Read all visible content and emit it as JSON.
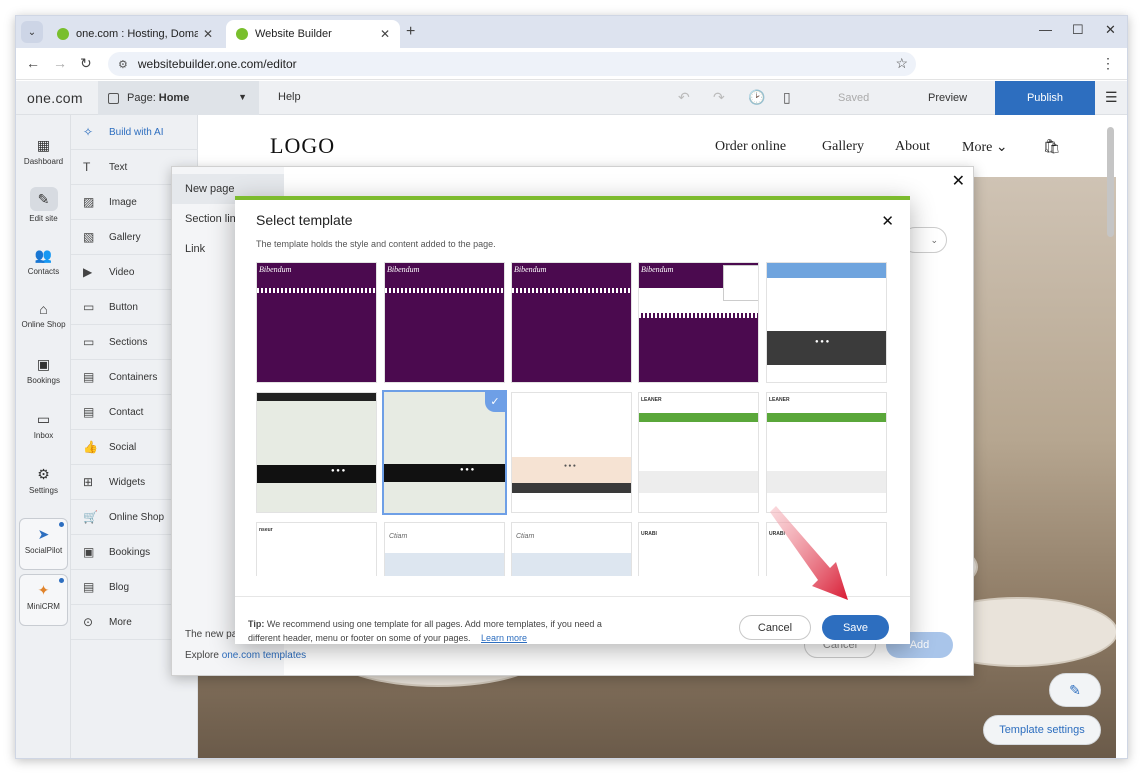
{
  "browser": {
    "tabs": [
      {
        "title": "one.com : Hosting, Domain, Email"
      },
      {
        "title": "Website Builder"
      }
    ],
    "url": "websitebuilder.one.com/editor"
  },
  "editor": {
    "brand": "one.com",
    "page_prefix": "Page:",
    "page_name": "Home",
    "help": "Help",
    "saved": "Saved",
    "preview": "Preview",
    "publish": "Publish"
  },
  "rail": [
    {
      "label": "Dashboard"
    },
    {
      "label": "Edit site"
    },
    {
      "label": "Contacts"
    },
    {
      "label": "Online Shop"
    },
    {
      "label": "Bookings"
    },
    {
      "label": "Inbox"
    },
    {
      "label": "Settings"
    },
    {
      "label": "SocialPilot"
    },
    {
      "label": "MiniCRM"
    }
  ],
  "widgets": [
    {
      "label": "Build with AI"
    },
    {
      "label": "Text"
    },
    {
      "label": "Image"
    },
    {
      "label": "Gallery"
    },
    {
      "label": "Video"
    },
    {
      "label": "Button"
    },
    {
      "label": "Sections"
    },
    {
      "label": "Containers"
    },
    {
      "label": "Contact"
    },
    {
      "label": "Social"
    },
    {
      "label": "Widgets"
    },
    {
      "label": "Online Shop"
    },
    {
      "label": "Bookings"
    },
    {
      "label": "Blog"
    },
    {
      "label": "More"
    }
  ],
  "site": {
    "logo": "LOGO",
    "nav": [
      "Order online",
      "Gallery",
      "About",
      "More"
    ],
    "template_settings": "Template settings"
  },
  "add_page_dialog": {
    "items": [
      "New page",
      "Section link",
      "Link"
    ],
    "footer_text": "The new page",
    "explore": "Explore",
    "explore_link": "one.com templates",
    "cancel": "Cancel",
    "add": "Add"
  },
  "template_dialog": {
    "title": "Select template",
    "subtitle": "The template holds the style and content added to the page.",
    "tip_label": "Tip:",
    "tip_text": "We recommend using one template for all pages. Add more templates, if you need a different header, menu or footer on some of your pages.",
    "learn_more": "Learn more",
    "cancel": "Cancel",
    "save": "Save",
    "thumbs": [
      {
        "name": "Bibendum"
      },
      {
        "name": "Bibendum"
      },
      {
        "name": "Bibendum"
      },
      {
        "name": "Bibendum"
      },
      {
        "name": ""
      },
      {
        "name": ""
      },
      {
        "name": "",
        "selected": true
      },
      {
        "name": ""
      },
      {
        "name": "LEANER"
      },
      {
        "name": "LEANER"
      },
      {
        "name": "nseur"
      },
      {
        "name": "Ctiam"
      },
      {
        "name": "Ctiam"
      },
      {
        "name": "URABI"
      },
      {
        "name": "URABI"
      }
    ]
  },
  "colors": {
    "accent": "#2d6ebf",
    "purple": "#4b0a4f",
    "green": "#7dbb2e"
  }
}
